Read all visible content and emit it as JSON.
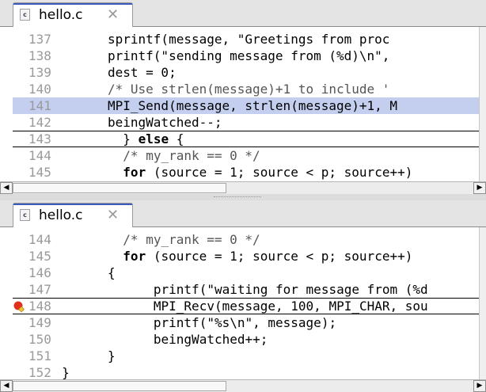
{
  "top_editor": {
    "tab": {
      "icon": "c-file-icon",
      "label": "hello.c"
    },
    "lines": [
      {
        "num": "137",
        "parts": [
          {
            "t": "sprintf(message, \"Greetings from proc"
          }
        ]
      },
      {
        "num": "138",
        "parts": [
          {
            "t": "printf(\"sending message from (%d)\\n\","
          }
        ]
      },
      {
        "num": "139",
        "parts": [
          {
            "t": "dest = 0;"
          }
        ]
      },
      {
        "num": "140",
        "parts": [
          {
            "t": "/* Use strlen(message)+1 to include '",
            "c": "cm"
          }
        ]
      },
      {
        "num": "141",
        "hl": true,
        "parts": [
          {
            "t": "MPI_Send(message, strlen(message)+1, M"
          }
        ]
      },
      {
        "num": "142",
        "parts": [
          {
            "t": "beingWatched--;"
          }
        ]
      },
      {
        "num": "143",
        "boxed": true,
        "indent": 2,
        "parts": [
          {
            "t": "} "
          },
          {
            "t": "else",
            "c": "kw"
          },
          {
            "t": " {"
          }
        ]
      },
      {
        "num": "144",
        "indent": 2,
        "parts": [
          {
            "t": "/* my_rank == 0 */",
            "c": "cm"
          }
        ]
      },
      {
        "num": "145",
        "indent": 2,
        "parts": [
          {
            "t": "for",
            "c": "kw"
          },
          {
            "t": " (source = 1; source < p; source++)"
          }
        ]
      }
    ]
  },
  "bottom_editor": {
    "tab": {
      "icon": "c-file-icon",
      "label": "hello.c"
    },
    "lines": [
      {
        "num": "144",
        "indent": 2,
        "parts": [
          {
            "t": "/* my_rank == 0 */",
            "c": "cm"
          }
        ]
      },
      {
        "num": "145",
        "indent": 2,
        "parts": [
          {
            "t": "for",
            "c": "kw"
          },
          {
            "t": " (source = 1; source < p; source++)"
          }
        ]
      },
      {
        "num": "146",
        "parts": [
          {
            "t": "{"
          }
        ]
      },
      {
        "num": "147",
        "indent": 6,
        "parts": [
          {
            "t": "printf(\"waiting for message from (%d"
          }
        ]
      },
      {
        "num": "148",
        "boxed": true,
        "breakpoint": true,
        "indent": 6,
        "parts": [
          {
            "t": "MPI_Recv(message, 100, MPI_CHAR, sou"
          }
        ]
      },
      {
        "num": "149",
        "indent": 6,
        "parts": [
          {
            "t": "printf(\"%s\\n\", message);"
          }
        ]
      },
      {
        "num": "150",
        "indent": 6,
        "parts": [
          {
            "t": "beingWatched++;"
          }
        ]
      },
      {
        "num": "151",
        "parts": [
          {
            "t": "}"
          }
        ]
      },
      {
        "num": "152",
        "indent": -6,
        "parts": [
          {
            "t": "}"
          }
        ]
      }
    ]
  },
  "icons": {
    "close": "close-tab-icon",
    "scroll_left": "scroll-left-arrow-icon",
    "scroll_right": "scroll-right-arrow-icon",
    "breakpoint": "breakpoint-icon"
  },
  "colors": {
    "highlight": "#c4cfef",
    "tab_accent": "#3b5bbf",
    "breakpoint": "#e03020"
  }
}
